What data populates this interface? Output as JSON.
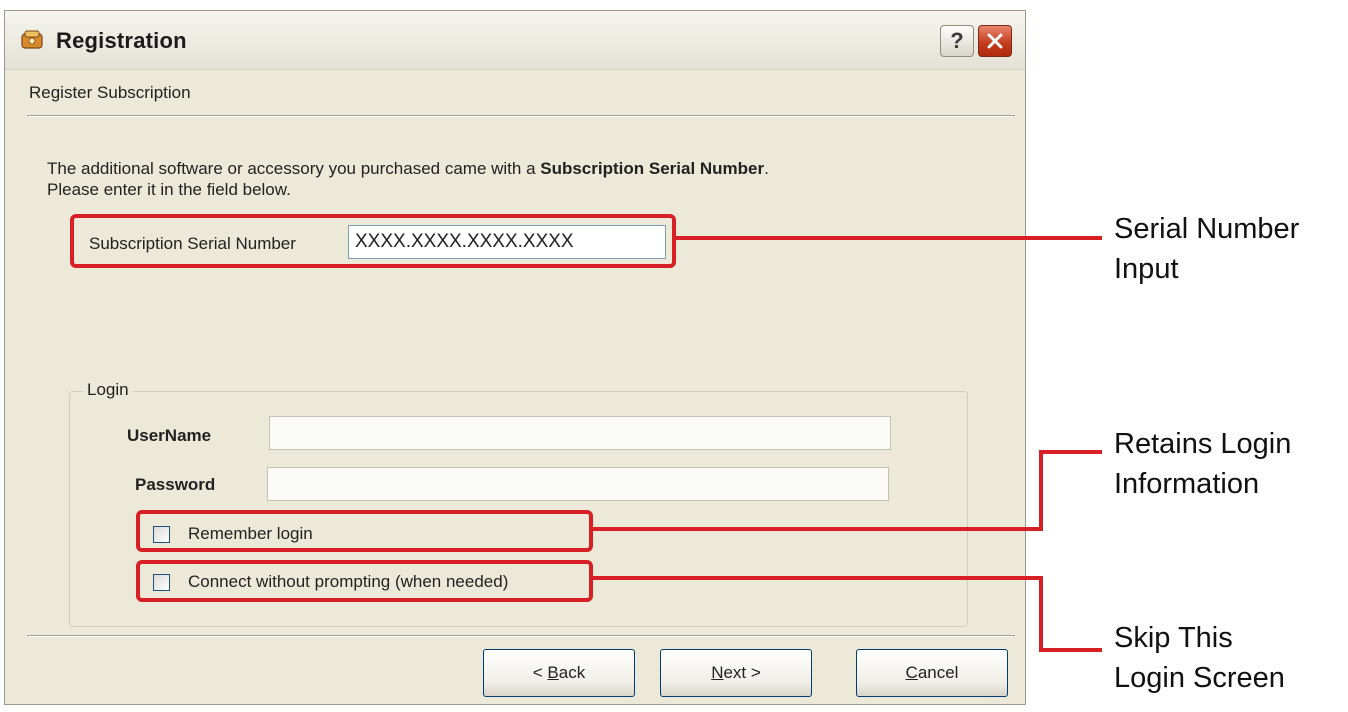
{
  "window": {
    "title": "Registration",
    "help_button": "?",
    "subtitle": "Register Subscription"
  },
  "intro": {
    "part1": "The additional software or accessory you purchased came with a ",
    "bold": "Subscription Serial Number",
    "part2": ".",
    "line2": "Please enter it in the field below."
  },
  "serial": {
    "label": "Subscription Serial Number",
    "value": "XXXX.XXXX.XXXX.XXXX"
  },
  "login": {
    "legend": "Login",
    "username_label": "UserName",
    "username_value": "",
    "password_label": "Password",
    "password_value": "",
    "remember_label": "Remember login",
    "remember_checked": false,
    "connect_label": "Connect without prompting (when needed)",
    "connect_checked": false
  },
  "buttons": {
    "back_prefix": "< ",
    "back_mnemonic": "B",
    "back_rest": "ack",
    "next_mnemonic": "N",
    "next_rest": "ext >",
    "cancel_mnemonic": "C",
    "cancel_rest": "ancel"
  },
  "callouts": {
    "serial": {
      "line1": "Serial Number",
      "line2": "Input"
    },
    "retains": {
      "line1": "Retains Login",
      "line2": "Information"
    },
    "skip": {
      "line1": "Skip This",
      "line2": "Login Screen"
    }
  },
  "colors": {
    "dialog_bg": "#ece9d8",
    "highlight": "#d81f26",
    "close_button": "#c23a1c"
  }
}
